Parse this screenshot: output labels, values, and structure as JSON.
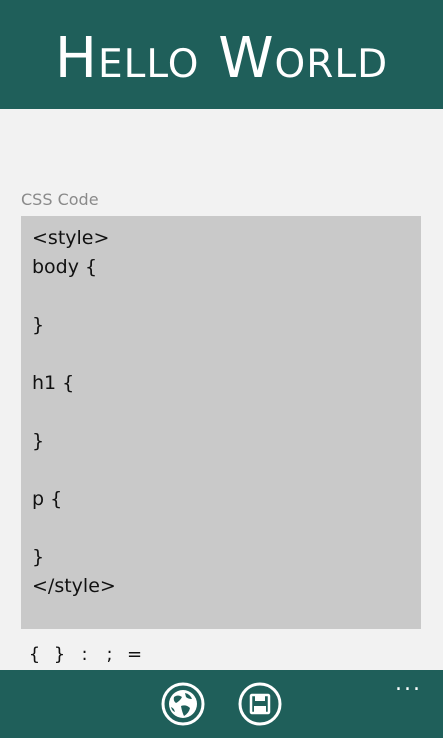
{
  "header": {
    "title": "Hello World"
  },
  "editor": {
    "label": "CSS Code",
    "lines": [
      "<style>",
      "body {",
      "",
      "}",
      "",
      "h1 {",
      "",
      "}",
      "",
      "p {",
      "",
      "}",
      "</style>"
    ]
  },
  "snippets": {
    "keys": [
      "{",
      "}",
      ":",
      ";",
      "="
    ]
  },
  "appbar": {
    "buttons": [
      {
        "icon": "globe-icon",
        "action": "preview"
      },
      {
        "icon": "save-icon",
        "action": "save"
      }
    ],
    "more": "..."
  },
  "colors": {
    "accent": "#1f5f5a",
    "background": "#f2f2f2",
    "code_background": "#c9c9c9"
  }
}
